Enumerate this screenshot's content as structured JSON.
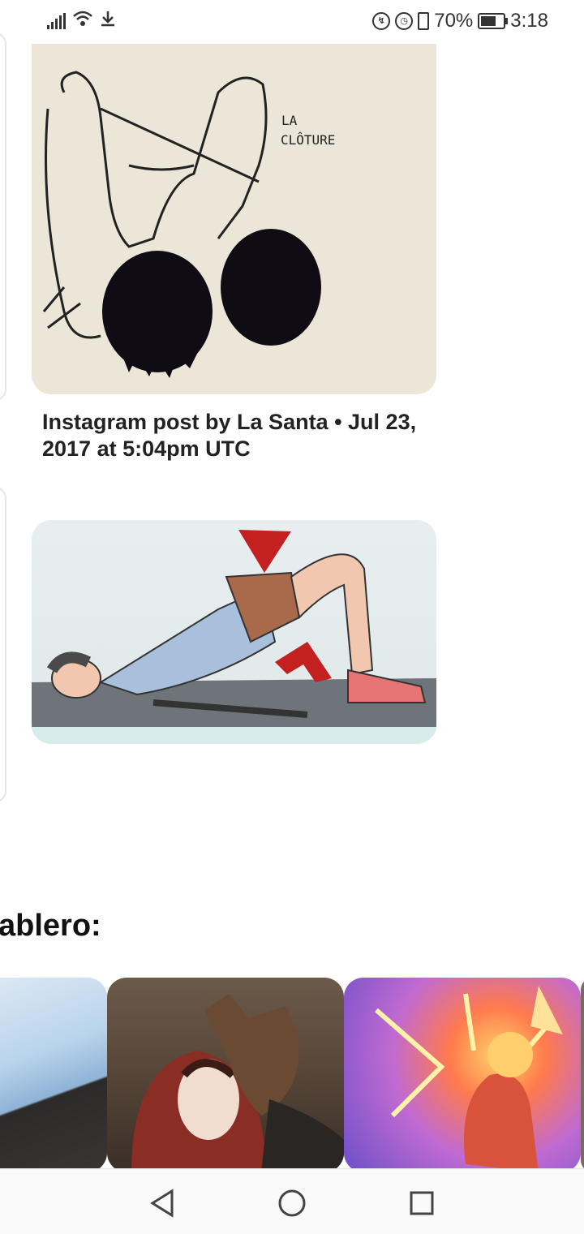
{
  "status_bar": {
    "battery_percent": "70%",
    "time": "3:18",
    "battery_level": 0.7,
    "icons": [
      "signal-icon",
      "wifi-icon",
      "download-icon",
      "data-saver-icon",
      "alarm-icon",
      "vibrate-icon",
      "battery-icon"
    ]
  },
  "feed": {
    "pins": [
      {
        "image_text": [
          "LA",
          "CLÔTURE"
        ],
        "caption": "Instagram post by La Santa • Jul 23, 2017 at 5:04pm UTC"
      },
      {
        "image_text": [],
        "caption": ""
      }
    ]
  },
  "board_section": {
    "title": "ablero:"
  },
  "nav_bar": {
    "icons": [
      "back-icon",
      "home-icon",
      "recents-icon"
    ]
  }
}
